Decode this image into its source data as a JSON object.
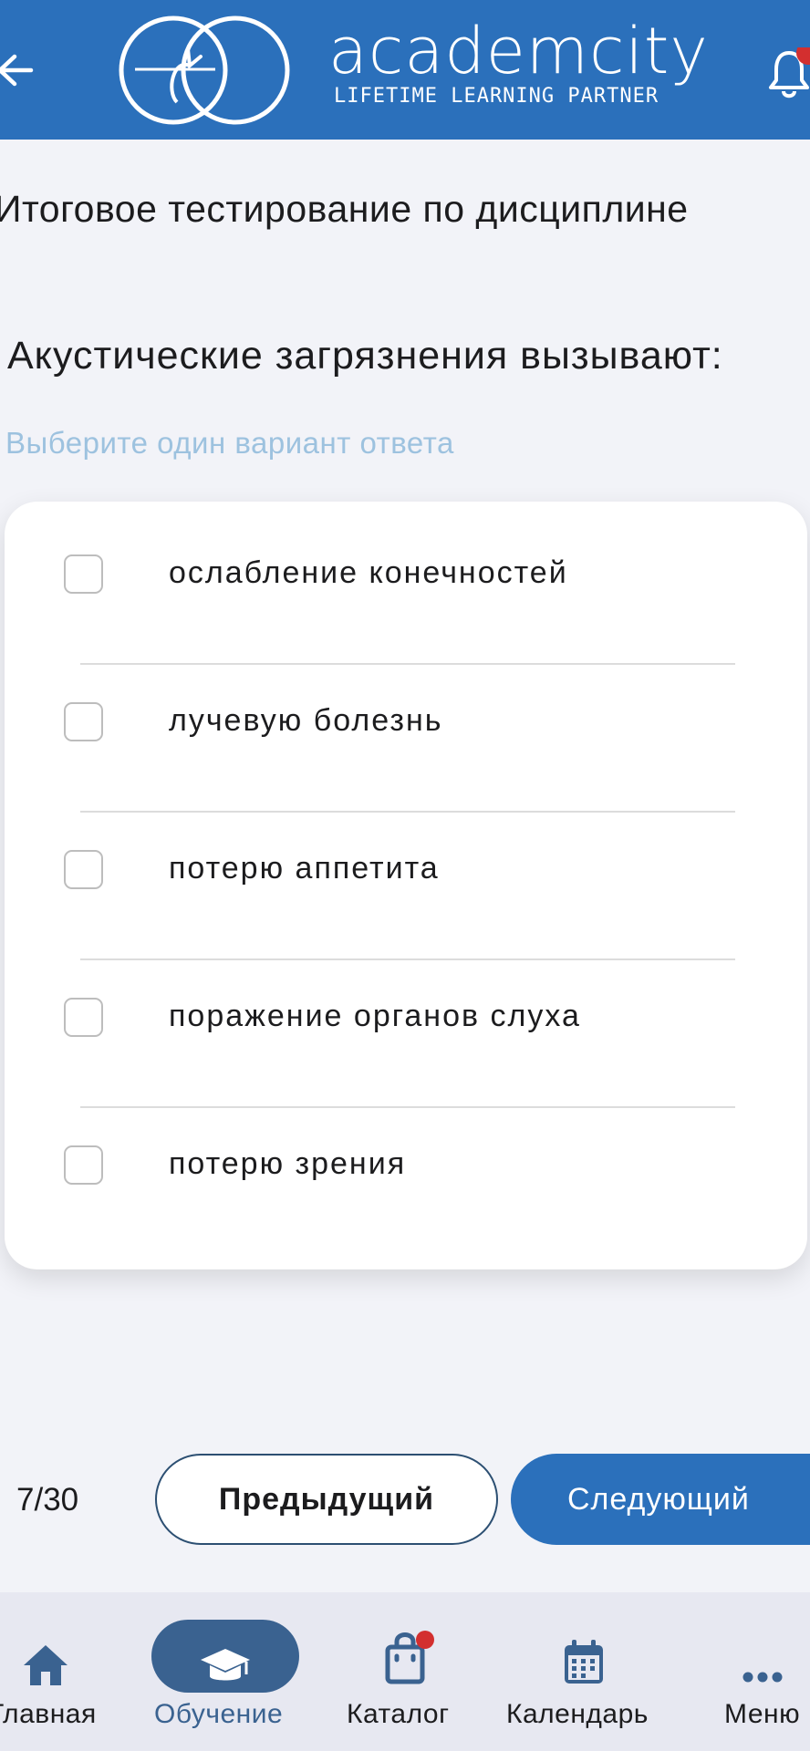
{
  "header": {
    "logo_text": "academcity",
    "logo_tagline": "LIFETIME LEARNING PARTNER",
    "back_icon": "arrow-left-icon",
    "bell_icon": "bell-icon",
    "bell_has_badge": true,
    "colors": {
      "background": "#2b70bb",
      "badge": "#d32f2f"
    }
  },
  "page": {
    "title": "Итоговое тестирование по дисциплине",
    "question": "Акустические загрязнения вызывают:",
    "hint": "Выберите один вариант ответа"
  },
  "options": [
    {
      "label": "ослабление конечностей",
      "checked": false
    },
    {
      "label": "лучевую болезнь",
      "checked": false
    },
    {
      "label": "потерю аппетита",
      "checked": false
    },
    {
      "label": "поражение органов слуха",
      "checked": false
    },
    {
      "label": "потерю зрения",
      "checked": false
    }
  ],
  "footer": {
    "counter": "7/30",
    "prev_label": "Предыдущий",
    "next_label": "Следующий"
  },
  "bottom_nav": {
    "items": [
      {
        "label": "Главная",
        "icon": "home-icon",
        "active": false,
        "badge": false
      },
      {
        "label": "Обучение",
        "icon": "graduation-cap-icon",
        "active": true,
        "badge": false
      },
      {
        "label": "Каталог",
        "icon": "shopping-bag-icon",
        "active": false,
        "badge": true
      },
      {
        "label": "Календарь",
        "icon": "calendar-icon",
        "active": false,
        "badge": false
      },
      {
        "label": "Меню",
        "icon": "more-dots-icon",
        "active": false,
        "badge": false
      }
    ],
    "colors": {
      "icon": "#3a6290",
      "active_label": "#3a6290",
      "badge": "#d32f2f"
    }
  }
}
